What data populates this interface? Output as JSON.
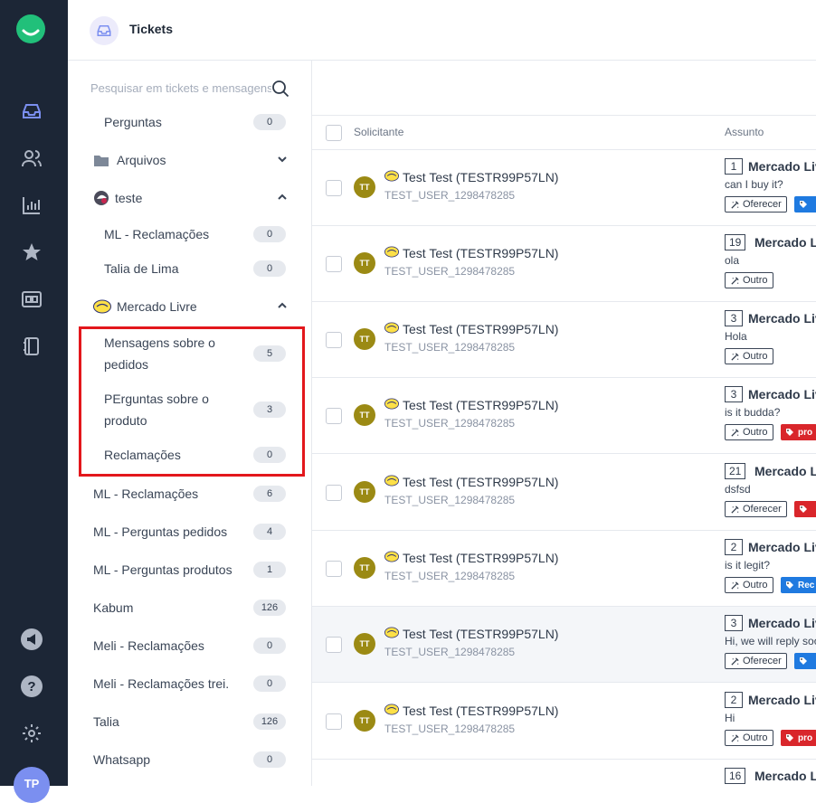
{
  "header": {
    "title": "Tickets"
  },
  "search": {
    "placeholder": "Pesquisar em tickets e mensagens"
  },
  "sidebar": {
    "perguntas": {
      "label": "Perguntas",
      "count": "0"
    },
    "arquivos": {
      "label": "Arquivos"
    },
    "teste": {
      "label": "teste",
      "items": [
        {
          "label": "ML - Reclamações",
          "count": "0"
        },
        {
          "label": "Talia de Lima",
          "count": "0"
        }
      ]
    },
    "mercado_livre": {
      "label": "Mercado Livre",
      "items": [
        {
          "label_1": "Mensagens sobre o",
          "label_2": "pedidos",
          "count": "5"
        },
        {
          "label_1": "PErguntas sobre o",
          "label_2": "produto",
          "count": "3"
        },
        {
          "label_1": "Reclamações",
          "count": "0"
        }
      ]
    },
    "groups": [
      {
        "label": "ML - Reclamações",
        "count": "6"
      },
      {
        "label": "ML - Perguntas pedidos",
        "count": "4"
      },
      {
        "label": "ML - Perguntas produtos",
        "count": "1"
      },
      {
        "label": "Kabum",
        "count": "126"
      },
      {
        "label": "Meli - Reclamações",
        "count": "0"
      },
      {
        "label": "Meli - Reclamações trei.",
        "count": "0"
      },
      {
        "label": "Talia",
        "count": "126"
      },
      {
        "label": "Whatsapp",
        "count": "0"
      }
    ]
  },
  "table": {
    "col_requester": "Solicitante",
    "col_subject": "Assunto"
  },
  "tickets": [
    {
      "initials": "TT",
      "name": "Test Test (TESTR99P57LN)",
      "user": "TEST_USER_1298478285",
      "num": "1",
      "subject": "Mercado Livre",
      "msg": "can I buy it?",
      "tag": "Oferecer",
      "ctag": "blue",
      "ctag_text": ""
    },
    {
      "initials": "TT",
      "name": "Test Test (TESTR99P57LN)",
      "user": "TEST_USER_1298478285",
      "num": "19",
      "subject": "Mercado Livre",
      "msg": "ola",
      "tag": "Outro",
      "ctag": "",
      "ctag_text": ""
    },
    {
      "initials": "TT",
      "name": "Test Test (TESTR99P57LN)",
      "user": "TEST_USER_1298478285",
      "num": "3",
      "subject": "Mercado Livre",
      "msg": "Hola",
      "tag": "Outro",
      "ctag": "",
      "ctag_text": ""
    },
    {
      "initials": "TT",
      "name": "Test Test (TESTR99P57LN)",
      "user": "TEST_USER_1298478285",
      "num": "3",
      "subject": "Mercado Livre",
      "msg": "is it budda?",
      "tag": "Outro",
      "ctag": "red",
      "ctag_text": "pro"
    },
    {
      "initials": "TT",
      "name": "Test Test (TESTR99P57LN)",
      "user": "TEST_USER_1298478285",
      "num": "21",
      "subject": "Mercado Livre",
      "msg": "dsfsd",
      "tag": "Oferecer",
      "ctag": "red",
      "ctag_text": ""
    },
    {
      "initials": "TT",
      "name": "Test Test (TESTR99P57LN)",
      "user": "TEST_USER_1298478285",
      "num": "2",
      "subject": "Mercado Livre",
      "msg": "is it legit?",
      "tag": "Outro",
      "ctag": "blue",
      "ctag_text": "Rec"
    },
    {
      "initials": "TT",
      "name": "Test Test (TESTR99P57LN)",
      "user": "TEST_USER_1298478285",
      "num": "3",
      "subject": "Mercado Livre",
      "msg": "Hi, we will reply soon",
      "tag": "Oferecer",
      "ctag": "blue",
      "ctag_text": ""
    },
    {
      "initials": "TT",
      "name": "Test Test (TESTR99P57LN)",
      "user": "TEST_USER_1298478285",
      "num": "2",
      "subject": "Mercado Livre",
      "msg": "Hi",
      "tag": "Outro",
      "ctag": "red",
      "ctag_text": "pro"
    }
  ],
  "partial_row": {
    "num": "16",
    "subject": "Mercado Livre"
  },
  "user": {
    "initials": "TP"
  },
  "colors": {
    "accent": "#7b8ff0",
    "rail": "#1c2636",
    "brand": "#21c07a",
    "highlight": "#e3171c",
    "tag_blue": "#1f7ae0",
    "tag_red": "#d9262b"
  }
}
